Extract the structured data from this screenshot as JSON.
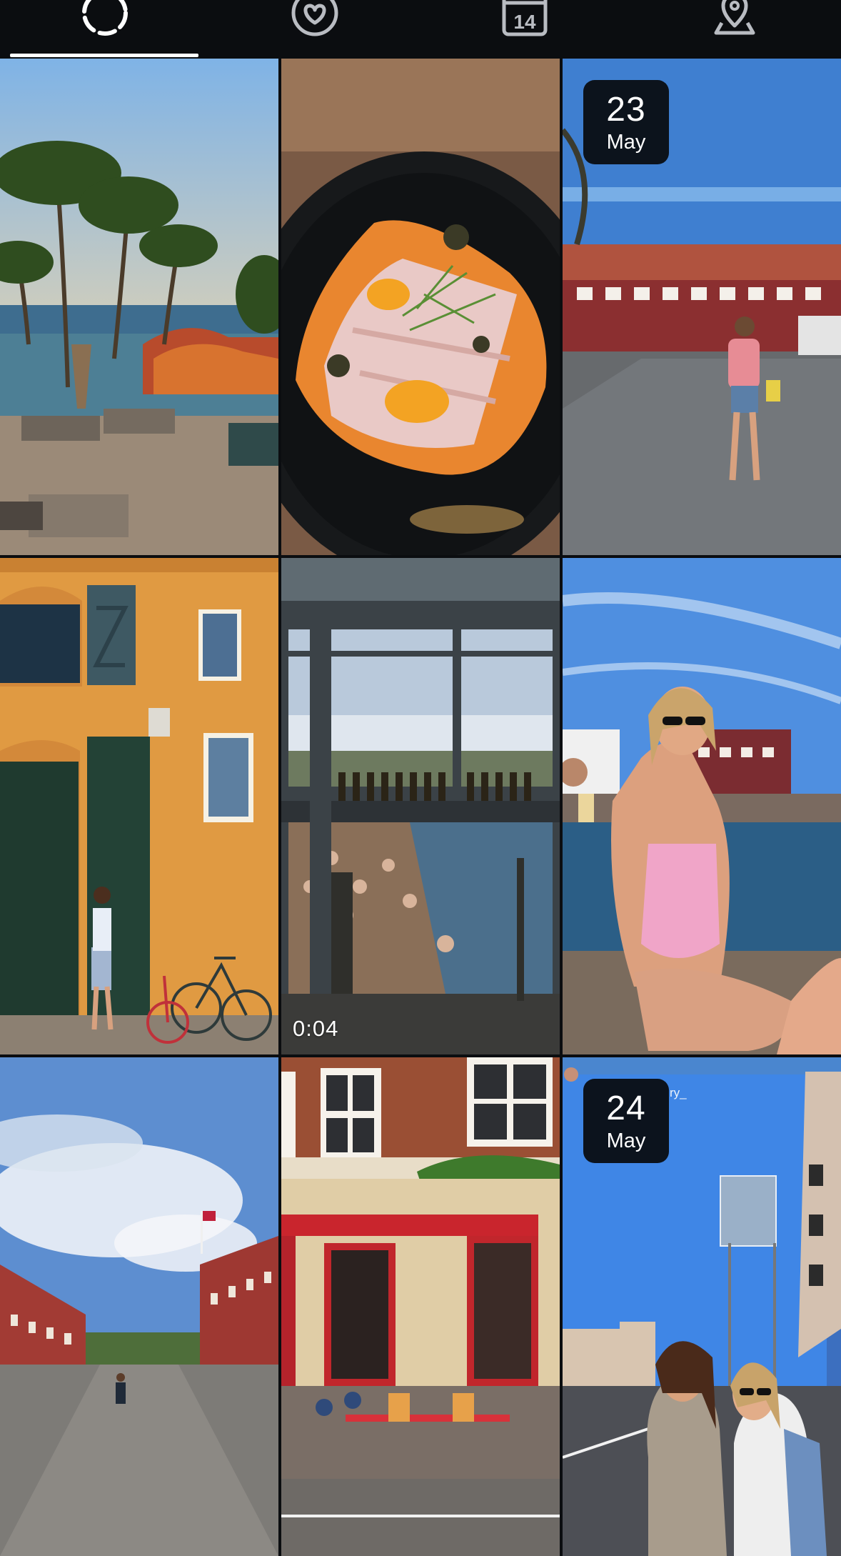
{
  "tabs": [
    {
      "name": "tab-all",
      "icon": "dashed-circle-icon",
      "active": true
    },
    {
      "name": "tab-favorites",
      "icon": "heart-circle-icon",
      "active": false
    },
    {
      "name": "tab-calendar",
      "icon": "calendar-icon",
      "calendar_day": "14",
      "active": false
    },
    {
      "name": "tab-places",
      "icon": "location-pin-icon",
      "active": false
    }
  ],
  "grid": {
    "items": [
      {
        "subject": "resort pool with palm trees at sunset"
      },
      {
        "subject": "plated fish crudo with herbs"
      },
      {
        "subject": "woman in pink top by red harbour building",
        "date_day": "23",
        "date_month": "May"
      },
      {
        "subject": "woman by orange building with bicycles"
      },
      {
        "subject": "video of harbour swimmers through window",
        "duration": "0:04"
      },
      {
        "subject": "woman in pink swimsuit holding wine by water"
      },
      {
        "subject": "cobbled street between red barracks"
      },
      {
        "subject": "canal-side cafe with red awnings"
      },
      {
        "subject": "two women smiling on a sunny street",
        "date_day": "24",
        "date_month": "May",
        "caption_fragment": "ry_"
      }
    ]
  },
  "colors": {
    "background": "#0b0d10",
    "tab_icon": "#b9bcc2",
    "active_indicator": "#ffffff",
    "badge_background": "#080a0c"
  }
}
